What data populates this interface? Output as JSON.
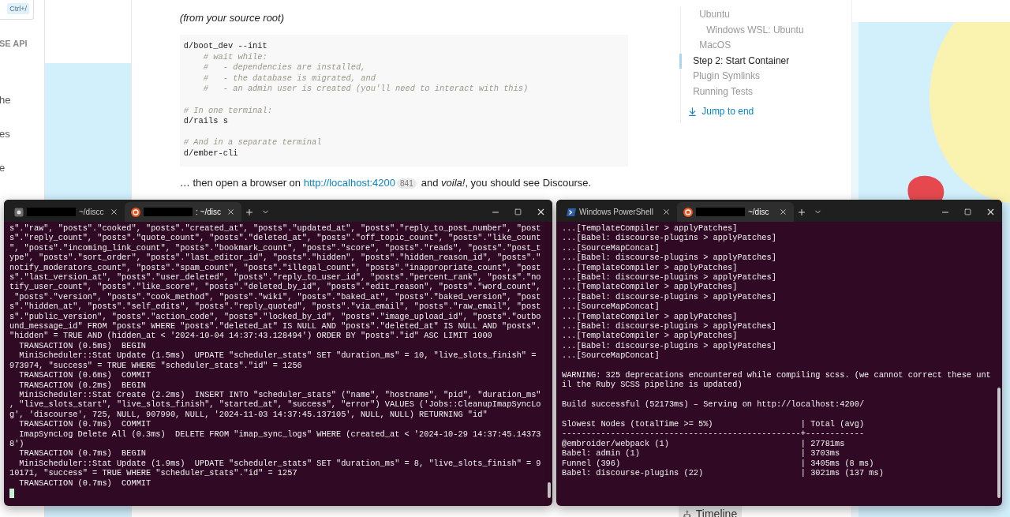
{
  "browser_page": {
    "search_shortcut": "Ctrl+/",
    "sidebar_items": [
      {
        "text": "SE API",
        "kind": "heading"
      },
      {
        "text": "he",
        "kind": "link"
      },
      {
        "text": "es",
        "kind": "link"
      },
      {
        "text": "e",
        "kind": "link"
      }
    ],
    "intro": "(from your source root)",
    "code_groups": [
      {
        "lines": [
          {
            "text": "d/boot_dev --init",
            "kind": "code"
          },
          {
            "text": "    # wait while:",
            "kind": "comment"
          },
          {
            "text": "    #   - dependencies are installed,",
            "kind": "comment"
          },
          {
            "text": "    #   - the database is migrated, and",
            "kind": "comment"
          },
          {
            "text": "    #   - an admin user is created (you'll need to interact with this)",
            "kind": "comment"
          }
        ]
      },
      {
        "lines": [
          {
            "text": "# In one terminal:",
            "kind": "comment"
          },
          {
            "text": "d/rails s",
            "kind": "code"
          }
        ]
      },
      {
        "lines": [
          {
            "text": "# And in a separate terminal",
            "kind": "comment"
          },
          {
            "text": "d/ember-cli",
            "kind": "code"
          }
        ]
      }
    ],
    "paragraph": {
      "before": "… then open a browser on",
      "link": "http://localhost:4200",
      "link_count": "841",
      "after": "and *voila!*, you should see Discourse."
    },
    "toc": {
      "nested_items": [
        {
          "label": "Ubuntu",
          "selected": false,
          "children": [
            {
              "label": "Windows WSL: Ubuntu",
              "selected": false
            }
          ]
        },
        {
          "label": "MacOS",
          "selected": false
        }
      ],
      "items": [
        {
          "label": "Step 2: Start Container",
          "selected": true
        },
        {
          "label": "Plugin Symlinks",
          "selected": false
        },
        {
          "label": "Running Tests",
          "selected": false
        }
      ],
      "jump_link": "Jump to end"
    },
    "timeline_button": "Timeline"
  },
  "terminal_windows": [
    {
      "tabs": [
        {
          "label": "~/discc",
          "kind": "linux",
          "redacted": true,
          "selected": false
        },
        {
          "label": ": ~/disc",
          "kind": "ubuntu",
          "redacted": true,
          "selected": true
        }
      ],
      "line_groups": [
        {
          "lines": [
            {
              "text": "s\".\"raw\", \"posts\".\"cooked\", \"posts\".\"created_at\", \"posts\".\"updated_at\", \"posts\".\"reply_to_post_number\", \"post"
            },
            {
              "text": "s\".\"reply_count\", \"posts\".\"quote_count\", \"posts\".\"deleted_at\", \"posts\".\"off_topic_count\", \"posts\".\"like_count"
            },
            {
              "text": "\", \"posts\".\"incoming_link_count\", \"posts\".\"bookmark_count\", \"posts\".\"score\", \"posts\".\"reads\", \"posts\".\"post_t"
            },
            {
              "text": "ype\", \"posts\".\"sort_order\", \"posts\".\"last_editor_id\", \"posts\".\"hidden\", \"posts\".\"hidden_reason_id\", \"posts\".\""
            },
            {
              "text": "notify_moderators_count\", \"posts\".\"spam_count\", \"posts\".\"illegal_count\", \"posts\".\"inappropriate_count\", \"post"
            },
            {
              "text": "s\".\"last_version_at\", \"posts\".\"user_deleted\", \"posts\".\"reply_to_user_id\", \"posts\".\"percent_rank\", \"posts\".\"no"
            },
            {
              "text": "tify_user_count\", \"posts\".\"like_score\", \"posts\".\"deleted_by_id\", \"posts\".\"edit_reason\", \"posts\".\"word_count\","
            },
            {
              "text": " \"posts\".\"version\", \"posts\".\"cook_method\", \"posts\".\"wiki\", \"posts\".\"baked_at\", \"posts\".\"baked_version\", \"post"
            },
            {
              "text": "s\".\"hidden_at\", \"posts\".\"self_edits\", \"posts\".\"reply_quoted\", \"posts\".\"via_email\", \"posts\".\"raw_email\", \"post"
            },
            {
              "text": "s\".\"public_version\", \"posts\".\"action_code\", \"posts\".\"locked_by_id\", \"posts\".\"image_upload_id\", \"posts\".\"outbo"
            },
            {
              "text": "und_message_id\" FROM \"posts\" WHERE \"posts\".\"deleted_at\" IS NULL AND \"posts\".\"deleted_at\" IS NULL AND \"posts\"."
            },
            {
              "text": "\"hidden\" = TRUE AND (hidden_at < '2024-10-04 14:37:43.128494') ORDER BY \"posts\".\"id\" ASC LIMIT 1000"
            },
            {
              "text": "  TRANSACTION (0.5ms)  BEGIN"
            },
            {
              "text": "  MiniScheduler::Stat Update (1.5ms)  UPDATE \"scheduler_stats\" SET \"duration_ms\" = 10, \"live_slots_finish\" ="
            },
            {
              "text": "973974, \"success\" = TRUE WHERE \"scheduler_stats\".\"id\" = 1256"
            },
            {
              "text": "  TRANSACTION (0.6ms)  COMMIT"
            },
            {
              "text": "  TRANSACTION (0.2ms)  BEGIN"
            },
            {
              "text": "  MiniScheduler::Stat Create (2.2ms)  INSERT INTO \"scheduler_stats\" (\"name\", \"hostname\", \"pid\", \"duration_ms\""
            },
            {
              "text": ", \"live_slots_start\", \"live_slots_finish\", \"started_at\", \"success\", \"error\") VALUES ('Jobs::CleanupImapSyncLo"
            },
            {
              "text": "g', 'discourse', 725, NULL, 907990, NULL, '2024-11-03 14:37:45.137105', NULL, NULL) RETURNING \"id\""
            },
            {
              "text": "  TRANSACTION (0.7ms)  COMMIT"
            },
            {
              "text": "  ImapSyncLog Delete All (0.3ms)  DELETE FROM \"imap_sync_logs\" WHERE (created_at < '2024-10-29 14:37:45.14373"
            },
            {
              "text": "8')"
            },
            {
              "text": "  TRANSACTION (0.7ms)  BEGIN"
            },
            {
              "text": "  MiniScheduler::Stat Update (1.9ms)  UPDATE \"scheduler_stats\" SET \"duration_ms\" = 8, \"live_slots_finish\" = 9"
            },
            {
              "text": "10171, \"success\" = TRUE WHERE \"scheduler_stats\".\"id\" = 1257"
            },
            {
              "text": "  TRANSACTION (0.7ms)  COMMIT"
            }
          ]
        }
      ]
    },
    {
      "tabs": [
        {
          "label": "Windows PowerShell",
          "kind": "powershell",
          "redacted": false,
          "selected": false
        },
        {
          "label": "~/disc",
          "kind": "ubuntu",
          "redacted": true,
          "selected": true
        }
      ],
      "line_groups": [
        {
          "lines": [
            {
              "text": "...[TemplateCompiler > applyPatches]"
            },
            {
              "text": "...[Babel: discourse-plugins > applyPatches]"
            },
            {
              "text": "...[SourceMapConcat]"
            },
            {
              "text": "...[Babel: discourse-plugins > applyPatches]"
            },
            {
              "text": "...[TemplateCompiler > applyPatches]"
            },
            {
              "text": "...[Babel: discourse-plugins > applyPatches]"
            },
            {
              "text": "...[TemplateCompiler > applyPatches]"
            },
            {
              "text": "...[Babel: discourse-plugins > applyPatches]"
            },
            {
              "text": "...[SourceMapConcat]"
            },
            {
              "text": "...[TemplateCompiler > applyPatches]"
            },
            {
              "text": "...[Babel: discourse-plugins > applyPatches]"
            },
            {
              "text": "...[TemplateCompiler > applyPatches]"
            },
            {
              "text": "...[Babel: discourse-plugins > applyPatches]"
            },
            {
              "text": "...[SourceMapConcat]"
            }
          ]
        },
        {
          "lines": [
            {
              "text": "WARNING: 325 deprecations encountered while compiling scss. (we cannot correct these unt"
            },
            {
              "text": "il the Ruby SCSS pipeline is updated)"
            }
          ]
        },
        {
          "lines": [
            {
              "text": "Build successful (52173ms) – Serving on http://localhost:4200/"
            }
          ]
        },
        {
          "lines": [
            {
              "text": "Slowest Nodes (totalTime >= 5%)                  | Total (avg)"
            },
            {
              "text": "-------------------------------------------------+------------"
            },
            {
              "text": "@embroider/webpack (1)                           | 27781ms"
            },
            {
              "text": "Babel: admin (1)                                 | 3703ms"
            },
            {
              "text": "Funnel (396)                                     | 3405ms (8 ms)"
            },
            {
              "text": "Babel: discourse-plugins (22)                    | 3021ms (137 ms)"
            }
          ]
        }
      ]
    }
  ]
}
